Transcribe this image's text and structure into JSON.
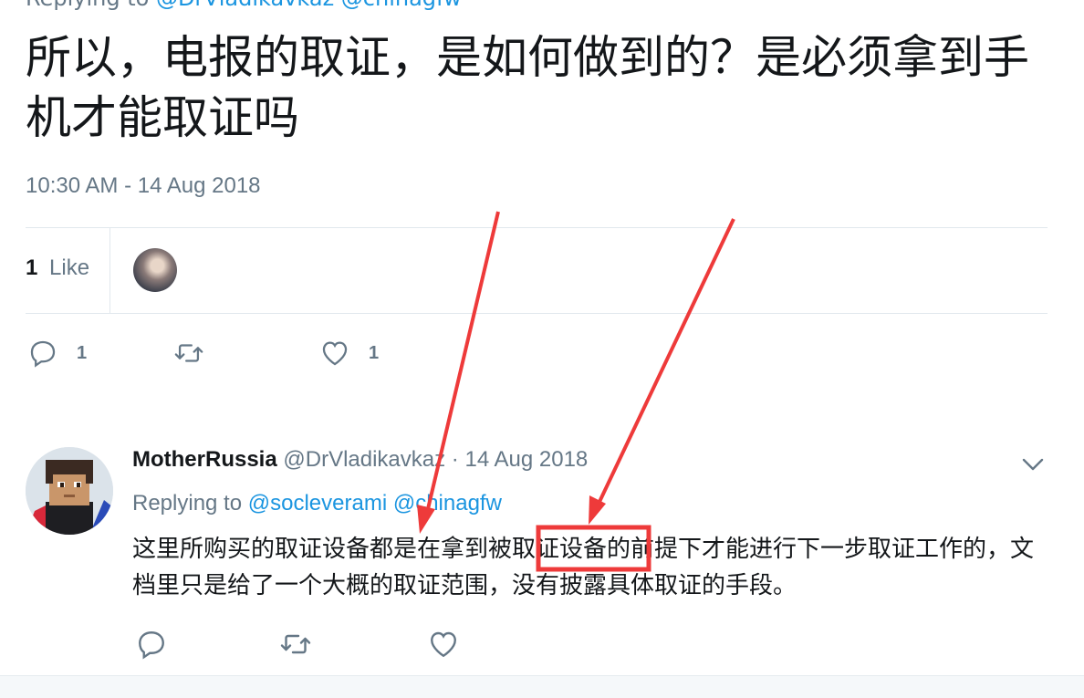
{
  "top_reply": {
    "prefix": "Replying to",
    "mentions": "@DrVladikavkaz @chinagfw"
  },
  "tweet": {
    "text": "所以，电报的取证，是如何做到的？是必须拿到手机才能取证吗",
    "timestamp": "10:30 AM - 14 Aug 2018",
    "likes_count": "1",
    "likes_label": "Like"
  },
  "actions": {
    "reply_count": "1",
    "retweet_count": "",
    "like_count": "1"
  },
  "reply": {
    "name": "MotherRussia",
    "handle": "@DrVladikavkaz",
    "separator": "·",
    "date": "14 Aug 2018",
    "replying_prefix": "Replying to",
    "mention_1": "@socleverami",
    "mention_2": "@chinagfw",
    "text": "这里所购买的取证设备都是在拿到被取证设备的前提下才能进行下一步取证工作的，文档里只是给了一个大概的取证范围，没有披露具体取证的手段。"
  },
  "colors": {
    "text": "#14171a",
    "muted": "#657786",
    "link": "#1b95e0",
    "annotation": "#ee3a3a"
  },
  "icons": [
    "reply-icon",
    "retweet-icon",
    "heart-icon",
    "chevron-down-icon"
  ]
}
